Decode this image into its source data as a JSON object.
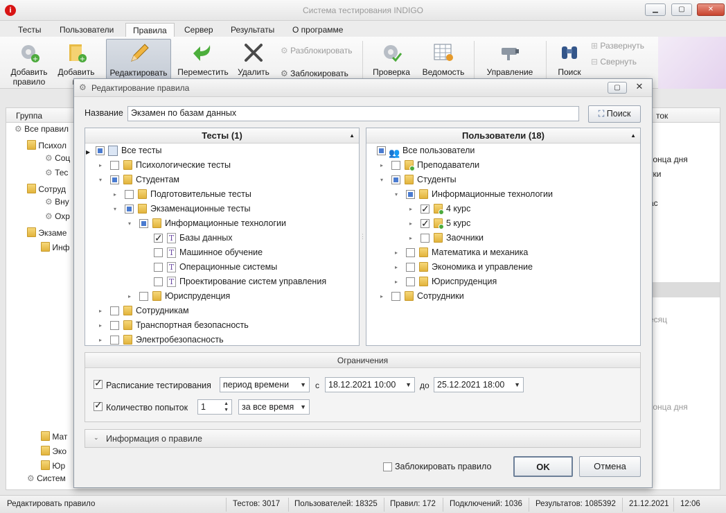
{
  "window": {
    "title": "Система тестирования INDIGO",
    "min": "▁",
    "max": "▢",
    "close": "✕"
  },
  "menu": {
    "tabs": [
      "Тесты",
      "Пользователи",
      "Правила",
      "Сервер",
      "Результаты",
      "О программе"
    ]
  },
  "ribbon": {
    "add_rule": "Добавить правило",
    "add_group": "Добавить гр",
    "edit": "Редактировать",
    "move": "Переместить",
    "delete": "Удалить",
    "unblock": "Разблокировать",
    "block": "Заблокировать",
    "check": "Проверка",
    "sheet": "Ведомость",
    "manage": "Управление",
    "search": "Поиск",
    "expand": "Развернуть",
    "collapse": "Свернуть"
  },
  "grid": {
    "col_group": "Группа",
    "col_right": "ток",
    "rows_left": [
      "Все правил",
      "Психол",
      "Соц",
      "Тес",
      "Сотруд",
      "Вну",
      "Охр",
      "Экзаме",
      "Инф",
      "Мат",
      "Эко",
      "Юр",
      "Систем"
    ],
    "rows_right": [
      "конца дня",
      "тки",
      "ас",
      "есяц",
      "конца дня"
    ]
  },
  "dialog": {
    "title": "Редактирование правила",
    "name_label": "Название",
    "name_value": "Экзамен по базам данных",
    "search_btn": "Поиск",
    "tests_header": "Тесты (1)",
    "users_header": "Пользователи (18)",
    "tests": [
      "Все тесты",
      "Психологические тесты",
      "Студентам",
      "Подготовительные тесты",
      "Экзаменационные тесты",
      "Информационные технологии",
      "Базы данных",
      "Машинное обучение",
      "Операционные системы",
      "Проектирование систем управления",
      "Юриспруденция",
      "Сотрудникам",
      "Транспортная безопасность",
      "Электробезопасность"
    ],
    "users": [
      "Все пользователи",
      "Преподаватели",
      "Студенты",
      "Информационные технологии",
      "4 курс",
      "5 курс",
      "Заочники",
      "Математика и механика",
      "Экономика и управление",
      "Юриспруденция",
      "Сотрудники"
    ],
    "restrictions_title": "Ограничения",
    "schedule_label": "Расписание тестирования",
    "schedule_mode": "период времени",
    "from_label": "с",
    "from_value": "18.12.2021 10:00",
    "to_label": "до",
    "to_value": "25.12.2021 18:00",
    "attempts_label": "Количество попыток",
    "attempts_value": "1",
    "attempts_mode": "за все время",
    "info_title": "Информация о правиле",
    "block_label": "Заблокировать правило",
    "ok": "OK",
    "cancel": "Отмена"
  },
  "status": {
    "action": "Редактировать правило",
    "tests": "Тестов: 3017",
    "users": "Пользователей: 18325",
    "rules": "Правил: 172",
    "connections": "Подключений: 1036",
    "results": "Результатов: 1085392",
    "date": "21.12.2021",
    "time": "12:06"
  }
}
